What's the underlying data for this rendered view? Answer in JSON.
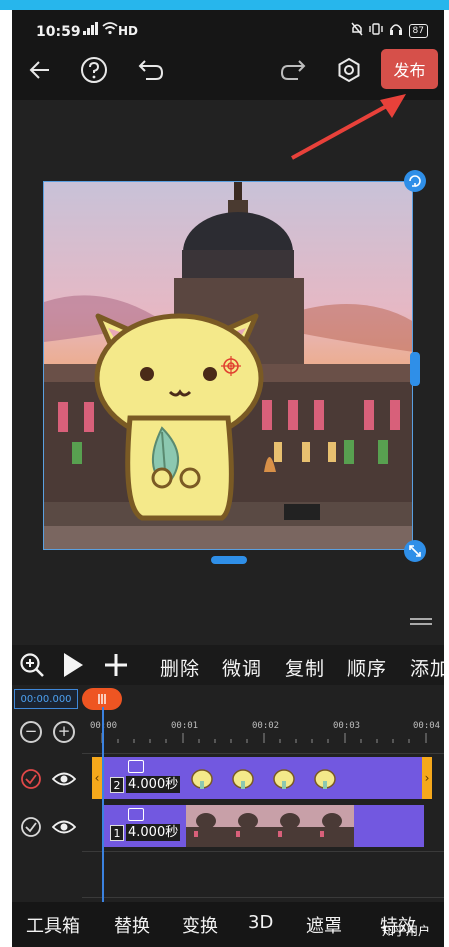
{
  "status_bar": {
    "time": "10:59",
    "signal": "ᵢₗ",
    "network": "HD",
    "battery": "87",
    "icons": [
      "mute-icon",
      "vibrate-icon",
      "headphone-icon",
      "battery-icon"
    ]
  },
  "toolbar": {
    "publish_label": "发布",
    "icons": [
      "back-arrow-icon",
      "help-icon",
      "undo-icon",
      "redo-icon",
      "settings-icon"
    ]
  },
  "edit_bar": {
    "actions": [
      "删除",
      "微调",
      "复制",
      "顺序",
      "添加"
    ],
    "icons": [
      "zoom-in-icon",
      "play-icon",
      "add-icon"
    ]
  },
  "timeline": {
    "timecode": "00:00.000",
    "ruler_labels": [
      "00:00",
      "00:01",
      "00:02",
      "00:03",
      "00:04"
    ],
    "tracks": [
      {
        "number": "2",
        "duration": "4.000秒",
        "checked_color": "#e04848"
      },
      {
        "number": "1",
        "duration": "4.000秒",
        "checked_color": "#d8d8d8"
      }
    ]
  },
  "bottom_bar": {
    "tabs": [
      "工具箱",
      "替换",
      "变换",
      "3D",
      "遮罩",
      "特效"
    ]
  },
  "watermark": "知乎用户",
  "colors": {
    "publish": "#d6504a",
    "accent": "#2f8fe8",
    "clip": "#7258e0",
    "clip_handle": "#f6a81b",
    "annotation_arrow": "#e8413a"
  }
}
